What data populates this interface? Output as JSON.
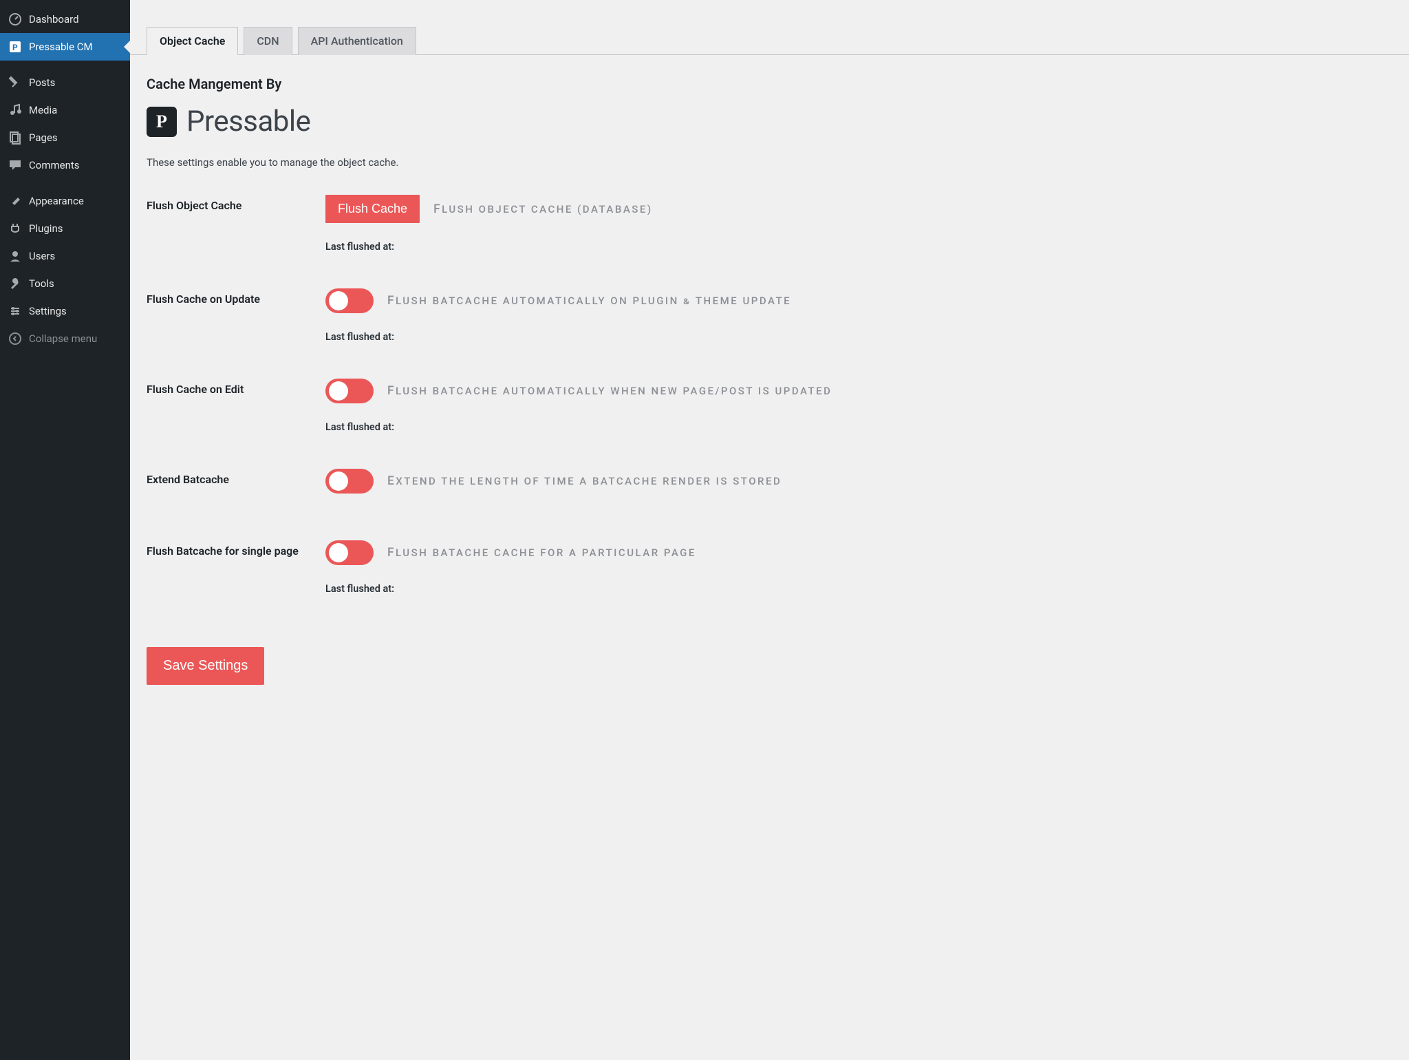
{
  "sidebar": {
    "items": [
      {
        "label": "Dashboard"
      },
      {
        "label": "Pressable CM"
      },
      {
        "label": "Posts"
      },
      {
        "label": "Media"
      },
      {
        "label": "Pages"
      },
      {
        "label": "Comments"
      },
      {
        "label": "Appearance"
      },
      {
        "label": "Plugins"
      },
      {
        "label": "Users"
      },
      {
        "label": "Tools"
      },
      {
        "label": "Settings"
      },
      {
        "label": "Collapse menu"
      }
    ]
  },
  "tabs": [
    {
      "label": "Object Cache"
    },
    {
      "label": "CDN"
    },
    {
      "label": "API Authentication"
    }
  ],
  "heading": "Cache Mangement By",
  "logo": {
    "glyph": "P",
    "text": "Pressable"
  },
  "description": "These settings enable you to manage the object cache.",
  "settings": {
    "flush_object": {
      "label": "Flush Object Cache",
      "button": "Flush Cache",
      "hint": "Flush object cache (Database)",
      "last_flushed": "Last flushed at:"
    },
    "on_update": {
      "label": "Flush Cache on Update",
      "hint": "Flush batcache automatically on plugin & theme update",
      "last_flushed": "Last flushed at:"
    },
    "on_edit": {
      "label": "Flush Cache on Edit",
      "hint": "Flush Batcache automatically when new page/post is updated",
      "last_flushed": "Last flushed at:"
    },
    "extend": {
      "label": "Extend Batcache",
      "hint": "Extend the length of time a Batcache render is stored"
    },
    "single": {
      "label": "Flush Batcache for single page",
      "hint": "Flush batache cache for a particular page",
      "last_flushed": "Last flushed at:"
    }
  },
  "save_label": "Save Settings",
  "colors": {
    "primary": "#eb5757",
    "sidebar_active": "#2271b1"
  }
}
